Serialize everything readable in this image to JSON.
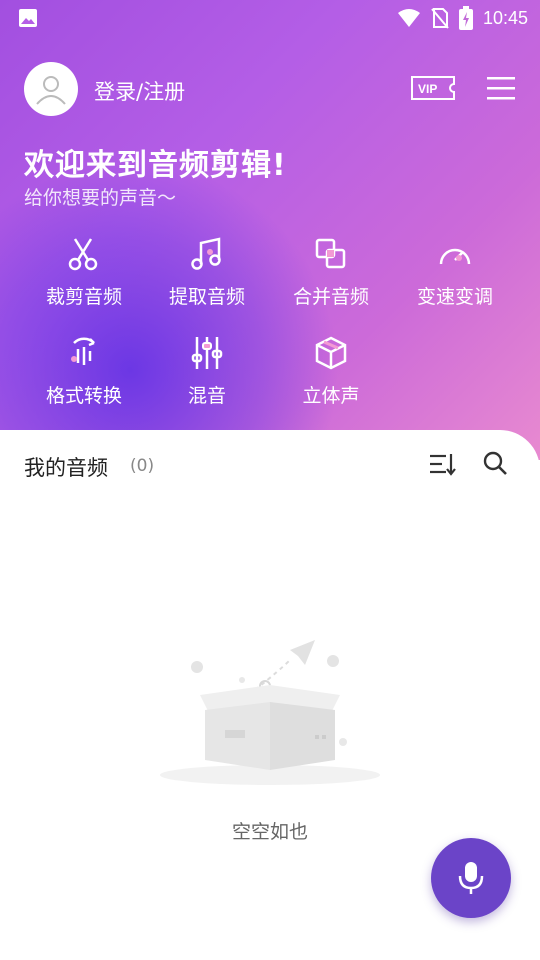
{
  "status_bar": {
    "time": "10:45"
  },
  "header": {
    "login_label": "登录/注册",
    "vip_label": "VIP"
  },
  "welcome": {
    "title": "欢迎来到音频剪辑!",
    "subtitle": "给你想要的声音～"
  },
  "tools": [
    {
      "label": "裁剪音频",
      "icon": "scissors-icon"
    },
    {
      "label": "提取音频",
      "icon": "music-note-icon"
    },
    {
      "label": "合并音频",
      "icon": "merge-icon"
    },
    {
      "label": "变速变调",
      "icon": "speedometer-icon"
    },
    {
      "label": "格式转换",
      "icon": "format-convert-icon"
    },
    {
      "label": "混音",
      "icon": "mixer-sliders-icon"
    },
    {
      "label": "立体声",
      "icon": "cube-icon"
    }
  ],
  "my_audio": {
    "title": "我的音频",
    "count": "(0)"
  },
  "empty_state": {
    "text": "空空如也"
  },
  "colors": {
    "accent": "#6b44c8",
    "gradient_start": "#5a38e6",
    "gradient_end": "#e88ad0"
  }
}
